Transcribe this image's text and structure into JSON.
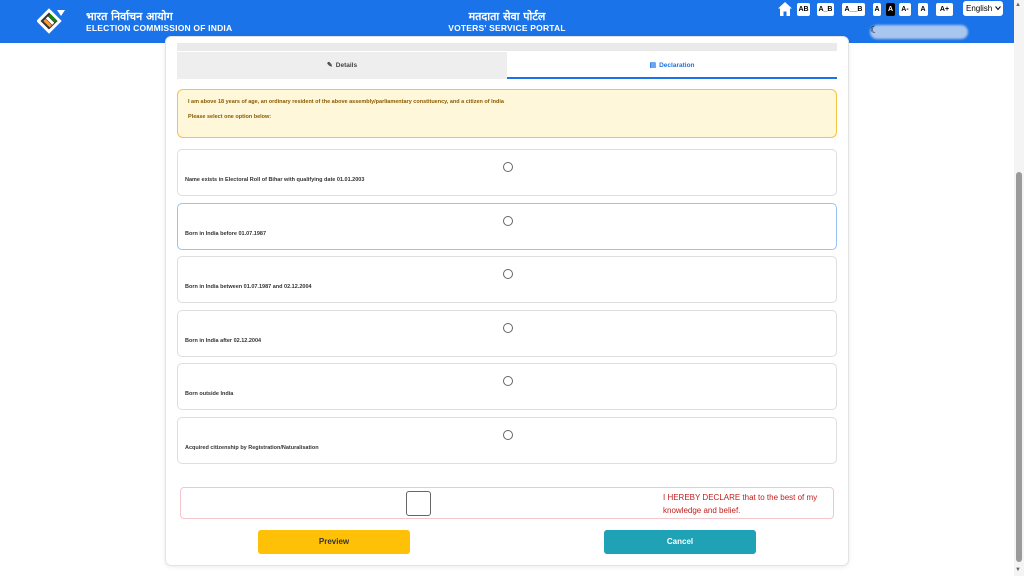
{
  "header": {
    "brand_hindi": "भारत निर्वाचन आयोग",
    "brand_english": "ELECTION COMMISSION OF INDIA",
    "portal_hindi": "मतदाता सेवा पोर्टल",
    "portal_english": "VOTERS' SERVICE PORTAL",
    "accessibility": [
      "AB",
      "A_B",
      "A__B",
      "A",
      "A",
      "A-",
      "A",
      "A+"
    ],
    "language": "English",
    "brand_color": "#1a73e8"
  },
  "tabs": [
    {
      "label": "Details",
      "icon": "edit-icon",
      "active": false
    },
    {
      "label": "Declaration",
      "icon": "document-icon",
      "active": true
    }
  ],
  "notice": {
    "line1": "I am above 18 years of age, an ordinary resident of the above assembly/parliamentary constituency, and a citizen of India",
    "line2": "Please select one option below:"
  },
  "options": [
    {
      "label": "Name exists in Electoral Roll of Bihar with qualifying date 01.01.2003"
    },
    {
      "label": "Born in India before 01.07.1987"
    },
    {
      "label": "Born in India between 01.07.1987 and 02.12.2004"
    },
    {
      "label": "Born in India after 02.12.2004"
    },
    {
      "label": "Born outside India"
    },
    {
      "label": "Acquired citizenship by Registration/Naturalisation"
    }
  ],
  "declaration": {
    "text": "I HEREBY DECLARE that to the best of my knowledge and belief.",
    "checked": false
  },
  "buttons": {
    "preview": "Preview",
    "cancel": "Cancel"
  }
}
